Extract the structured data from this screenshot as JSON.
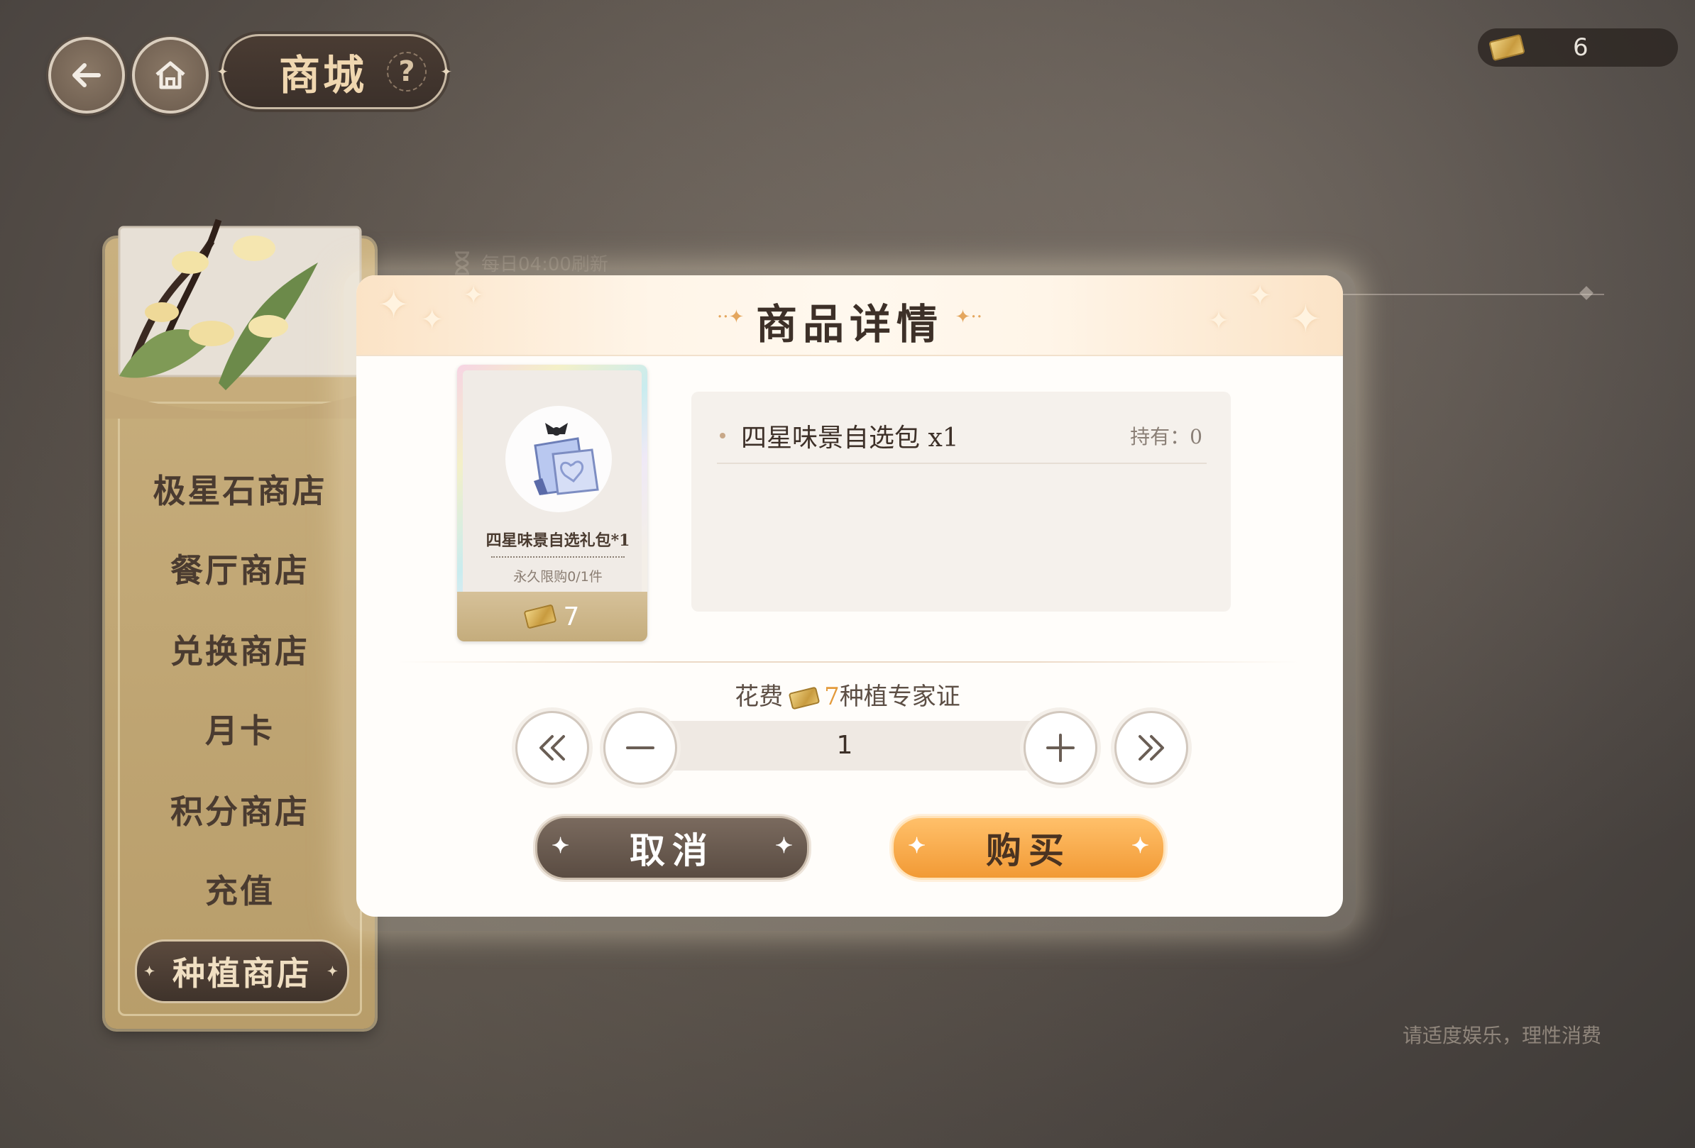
{
  "header": {
    "title": "商城",
    "help_glyph": "?",
    "back_icon": "back-arrow-icon",
    "home_icon": "home-icon"
  },
  "currency": {
    "icon": "planting-ticket-icon",
    "amount": "6"
  },
  "refresh_note": "每日04:00刷新",
  "sidebar": {
    "items": [
      {
        "label": "极星石商店"
      },
      {
        "label": "餐厅商店"
      },
      {
        "label": "兑换商店"
      },
      {
        "label": "月卡"
      },
      {
        "label": "积分商店"
      },
      {
        "label": "充值"
      }
    ],
    "active": "种植商店"
  },
  "modal": {
    "title": "商品详情",
    "card": {
      "name": "四星味景自选礼包*1",
      "limit": "永久限购0/1件",
      "price": "7"
    },
    "detail": {
      "item": "四星味景自选包 x1",
      "held": "持有：0"
    },
    "cost": {
      "prefix": "花费",
      "amount": "7",
      "suffix": "种植专家证"
    },
    "quantity": "1",
    "cancel_label": "取消",
    "buy_label": "购买"
  },
  "footer_note": "请适度娱乐，理性消费",
  "colors": {
    "accent": "#f29a35",
    "title_gold": "#f0d7b0",
    "cost_highlight": "#e39a3b"
  }
}
